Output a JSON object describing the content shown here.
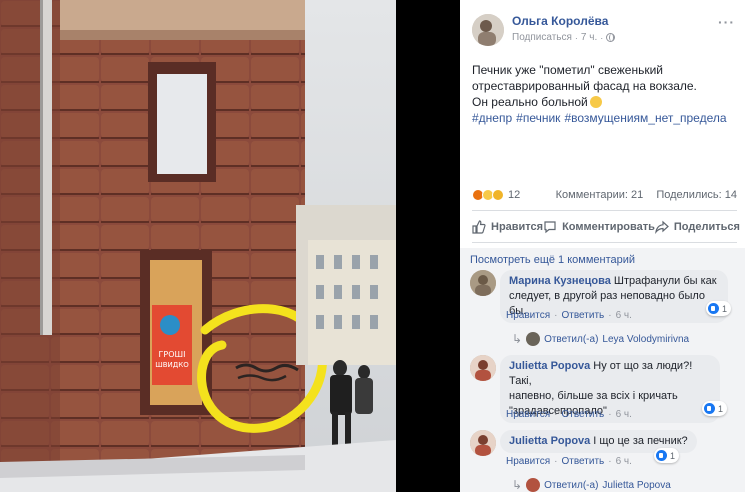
{
  "post": {
    "author": "Ольга Королёва",
    "follow": "Подписаться",
    "time": "7 ч.",
    "dot": "·",
    "more": "···",
    "text_line1": "Печник уже \"пометил\" свеженький",
    "text_line2": "отреставрированный фасад на вокзале.",
    "text_line3": "Он реально больной",
    "hashtags": [
      "#днепр",
      "#печник",
      "#возмущениям_нет_предела"
    ]
  },
  "reactions": {
    "count": "12",
    "comments": "Комментарии: 21",
    "shares": "Поделились: 14"
  },
  "actions": {
    "like": "Нравится",
    "comment": "Комментировать",
    "share": "Поделиться"
  },
  "comments": {
    "see_more": "Посмотреть ещё 1 комментарий",
    "items": [
      {
        "name": "Марина Кузнецова",
        "text1": "Штрафанули бы как",
        "text2": "следует, в другой раз неповадно было бы.",
        "likes": "1",
        "like_label": "Нравится",
        "reply_label": "Ответить",
        "time": "6 ч.",
        "sep": "·"
      },
      {
        "name": "Julietta Popova",
        "text1": "Ну от що за люди?! Такі,",
        "text2": "напевно, більше за всіх і кричать",
        "text3": "\"зрадавсепропало\"",
        "likes": "1",
        "like_label": "Нравится",
        "reply_label": "Ответить",
        "time": "6 ч.",
        "sep": "·"
      },
      {
        "name": "Julietta Popova",
        "text1": "І що це за печник?",
        "likes": "1",
        "like_label": "Нравится",
        "reply_label": "Ответить",
        "time": "6 ч.",
        "sep": "·"
      }
    ],
    "reply1": {
      "arrow": "↳",
      "label": "Ответил(-а)",
      "name": "Leya Volodymirivna"
    },
    "reply3": {
      "arrow": "↳",
      "label": "Ответил(-а)",
      "name": "Julietta Popova"
    }
  },
  "photo": {
    "sign_text1": "ГРОШІ",
    "sign_text2": "ШВИДКО"
  },
  "colors": {
    "link": "#365899",
    "brick": "#8e4b3d",
    "highlight": "#f4e21d"
  }
}
